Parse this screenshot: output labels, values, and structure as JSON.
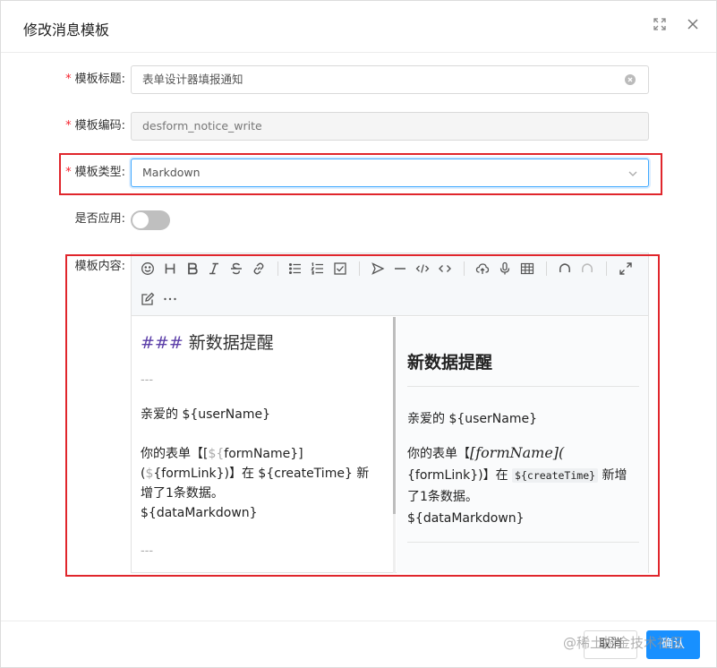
{
  "modal": {
    "title": "修改消息模板"
  },
  "form": {
    "title_field": {
      "label": "模板标题:",
      "value": "表单设计器填报通知"
    },
    "code_field": {
      "label": "模板编码:",
      "value": "desform_notice_write"
    },
    "type_field": {
      "label": "模板类型:",
      "value": "Markdown"
    },
    "apply_field": {
      "label": "是否应用:"
    },
    "content_field": {
      "label": "模板内容:"
    }
  },
  "editor": {
    "source": {
      "heading_hash": "###",
      "heading_text": " 新数据提醒",
      "hr": "---",
      "greeting": "亲爱的 ${userName}",
      "line1_a": "你的表单【[",
      "line1_b": "${",
      "line1_c": "formName}]",
      "line2_a": "(",
      "line2_b": "$",
      "line2_c": "{formLink})】在 ${createTime} 新",
      "line3": "增了1条数据。",
      "line4": "${dataMarkdown}",
      "hr2": "---"
    },
    "preview": {
      "heading": "新数据提醒",
      "greeting": "亲爱的 ${userName}",
      "p1_a": "你的表单【",
      "p1_math": "[formName](",
      "p2_a": "{formLink})】在 ",
      "p2_code": "${createTime}",
      "p2_b": " 新增",
      "p3": "了1条数据。",
      "p4": "${dataMarkdown}"
    }
  },
  "footer": {
    "cancel_label": "取消",
    "ok_label": "确认",
    "watermark": "@稀土掘金技术社区"
  },
  "colors": {
    "required": "#f5222d",
    "highlight": "#e0262c",
    "primary": "#1890ff"
  }
}
